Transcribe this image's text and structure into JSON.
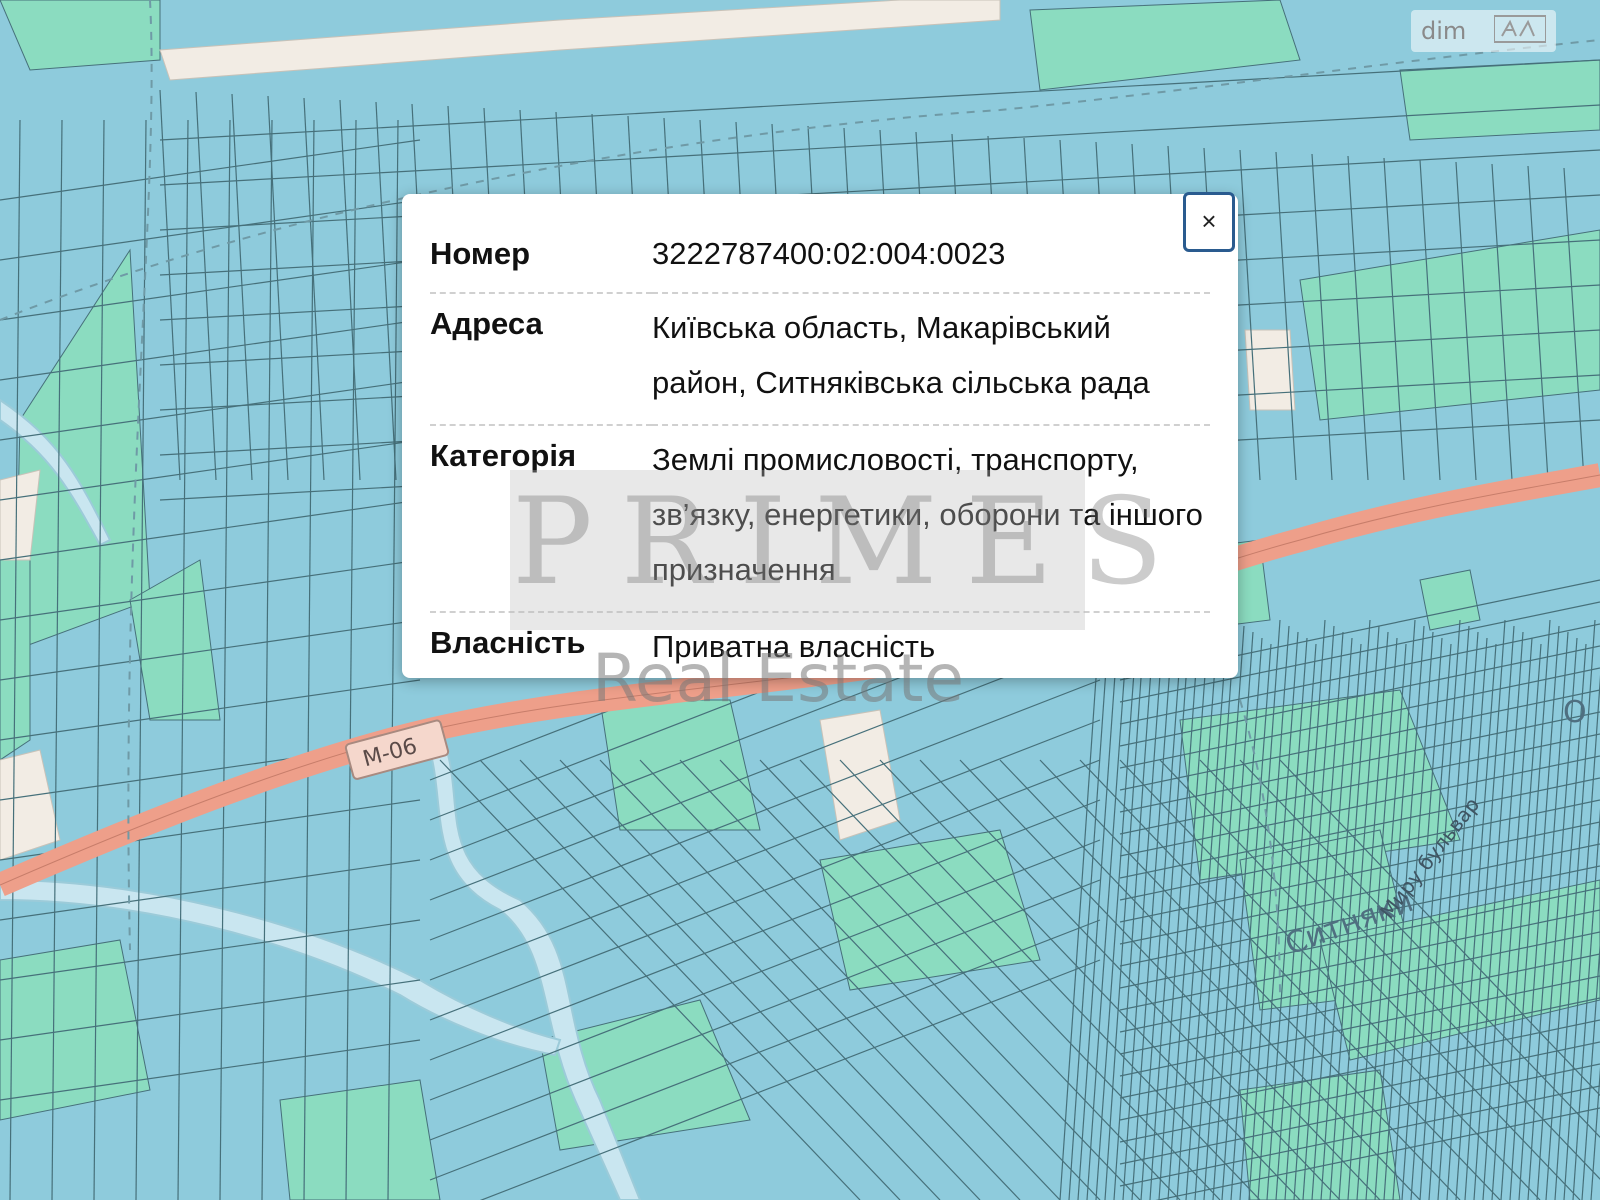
{
  "map": {
    "colors": {
      "parcel_blue": "#8ecbdc",
      "parcel_green": "#8bdcc0",
      "parcel_line": "#46707a",
      "road_main": "#ee9f8a",
      "road_secondary": "#f2ece4",
      "water": "#c9e6f0"
    },
    "road_shield": "M-06",
    "place_label": "Ситняки",
    "street_label": "Миру бульвар",
    "partial_label": "О"
  },
  "popup": {
    "close_icon": "close-icon",
    "close_label": "×",
    "rows": [
      {
        "key": "Номер",
        "value": "3222787400:02:004:0023"
      },
      {
        "key": "Адреса",
        "value": "Київська область, Макарівський район, Ситняківська сільська рада"
      },
      {
        "key": "Категорія",
        "value": "Землі промисловості, транспорту, зв’язку, енергетики, оборони та іншого призначення"
      },
      {
        "key": "Власність",
        "value": "Приватна власність"
      }
    ]
  },
  "watermark": {
    "letters": "PRIMES",
    "subtitle": "Real Estate"
  },
  "brand": {
    "label": "dim",
    "icon": "ria-logo-icon"
  }
}
